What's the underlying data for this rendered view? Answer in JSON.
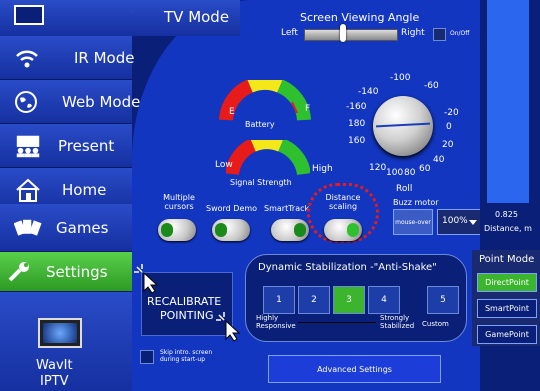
{
  "nav": {
    "tv_mode": "TV Mode",
    "ir_mode": "IR Mode",
    "web_mode": "Web Mode",
    "present": "Present",
    "home": "Home",
    "games": "Games",
    "settings": "Settings",
    "brand_line1": "WavIt",
    "brand_line2": "IPTV"
  },
  "screen_angle": {
    "title": "Screen Viewing Angle",
    "left": "Left",
    "right": "Right",
    "onoff": "On/Off"
  },
  "battery": {
    "label": "Battery",
    "empty": "E",
    "full": "F"
  },
  "signal": {
    "label": "Signal Strength",
    "low": "Low",
    "high": "High"
  },
  "roll": {
    "label": "Roll",
    "ticks": [
      "-140",
      "-100",
      "-60",
      "-160",
      "-20",
      "180",
      "0",
      "160",
      "20",
      "40",
      "120",
      "100",
      "80",
      "60"
    ]
  },
  "buzz": {
    "label": "Buzz motor",
    "mouse_over": "mouse-over",
    "percent": "100%"
  },
  "distance": {
    "value": "0.825",
    "label": "Distance, m"
  },
  "toggles": {
    "multiple_cursors_1": "Multiple",
    "multiple_cursors_2": "cursors",
    "sword_demo": "Sword Demo",
    "smart_track": "SmartTrack",
    "distance_scaling_1": "Distance",
    "distance_scaling_2": "scaling"
  },
  "recalibrate": {
    "line1": "RECALIBRATE",
    "line2": "POINTING"
  },
  "stabilization": {
    "title": "Dynamic Stabilization -\"Anti-Shake\"",
    "buttons": [
      "1",
      "2",
      "3",
      "4",
      "5"
    ],
    "highly_1": "Highly",
    "highly_2": "Responsive",
    "strongly_1": "Strongly",
    "strongly_2": "Stabilized",
    "custom": "Custom"
  },
  "point_mode": {
    "title": "Point Mode",
    "direct": "DirectPoint",
    "smart": "SmartPoint",
    "game": "GamePoint"
  },
  "skip_intro": {
    "line1": "Skip intro. screen",
    "line2": "during start-up"
  },
  "advanced": "Advanced Settings",
  "colors": {
    "accent_green": "#3bb52d",
    "panel_blue": "#1236c0",
    "dark_blue": "#0a1f78"
  }
}
